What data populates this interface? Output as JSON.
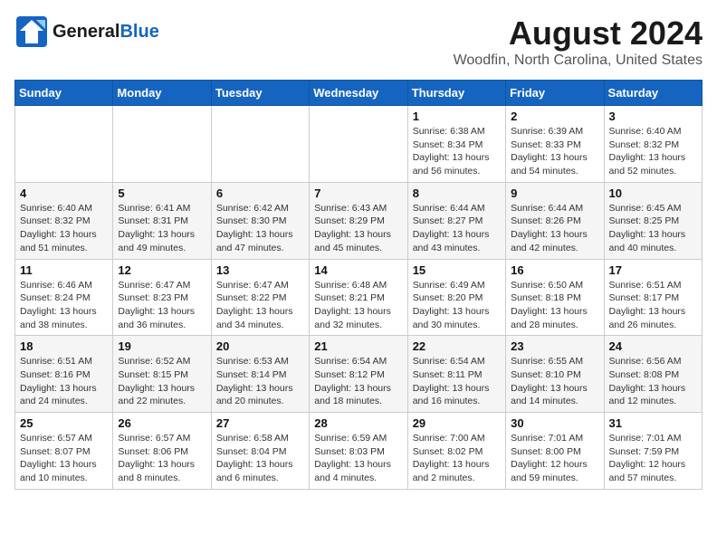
{
  "header": {
    "logo_line1": "General",
    "logo_line2": "Blue",
    "title": "August 2024",
    "subtitle": "Woodfin, North Carolina, United States"
  },
  "weekdays": [
    "Sunday",
    "Monday",
    "Tuesday",
    "Wednesday",
    "Thursday",
    "Friday",
    "Saturday"
  ],
  "weeks": [
    [
      {
        "day": "",
        "info": ""
      },
      {
        "day": "",
        "info": ""
      },
      {
        "day": "",
        "info": ""
      },
      {
        "day": "",
        "info": ""
      },
      {
        "day": "1",
        "info": "Sunrise: 6:38 AM\nSunset: 8:34 PM\nDaylight: 13 hours and 56 minutes."
      },
      {
        "day": "2",
        "info": "Sunrise: 6:39 AM\nSunset: 8:33 PM\nDaylight: 13 hours and 54 minutes."
      },
      {
        "day": "3",
        "info": "Sunrise: 6:40 AM\nSunset: 8:32 PM\nDaylight: 13 hours and 52 minutes."
      }
    ],
    [
      {
        "day": "4",
        "info": "Sunrise: 6:40 AM\nSunset: 8:32 PM\nDaylight: 13 hours and 51 minutes."
      },
      {
        "day": "5",
        "info": "Sunrise: 6:41 AM\nSunset: 8:31 PM\nDaylight: 13 hours and 49 minutes."
      },
      {
        "day": "6",
        "info": "Sunrise: 6:42 AM\nSunset: 8:30 PM\nDaylight: 13 hours and 47 minutes."
      },
      {
        "day": "7",
        "info": "Sunrise: 6:43 AM\nSunset: 8:29 PM\nDaylight: 13 hours and 45 minutes."
      },
      {
        "day": "8",
        "info": "Sunrise: 6:44 AM\nSunset: 8:27 PM\nDaylight: 13 hours and 43 minutes."
      },
      {
        "day": "9",
        "info": "Sunrise: 6:44 AM\nSunset: 8:26 PM\nDaylight: 13 hours and 42 minutes."
      },
      {
        "day": "10",
        "info": "Sunrise: 6:45 AM\nSunset: 8:25 PM\nDaylight: 13 hours and 40 minutes."
      }
    ],
    [
      {
        "day": "11",
        "info": "Sunrise: 6:46 AM\nSunset: 8:24 PM\nDaylight: 13 hours and 38 minutes."
      },
      {
        "day": "12",
        "info": "Sunrise: 6:47 AM\nSunset: 8:23 PM\nDaylight: 13 hours and 36 minutes."
      },
      {
        "day": "13",
        "info": "Sunrise: 6:47 AM\nSunset: 8:22 PM\nDaylight: 13 hours and 34 minutes."
      },
      {
        "day": "14",
        "info": "Sunrise: 6:48 AM\nSunset: 8:21 PM\nDaylight: 13 hours and 32 minutes."
      },
      {
        "day": "15",
        "info": "Sunrise: 6:49 AM\nSunset: 8:20 PM\nDaylight: 13 hours and 30 minutes."
      },
      {
        "day": "16",
        "info": "Sunrise: 6:50 AM\nSunset: 8:18 PM\nDaylight: 13 hours and 28 minutes."
      },
      {
        "day": "17",
        "info": "Sunrise: 6:51 AM\nSunset: 8:17 PM\nDaylight: 13 hours and 26 minutes."
      }
    ],
    [
      {
        "day": "18",
        "info": "Sunrise: 6:51 AM\nSunset: 8:16 PM\nDaylight: 13 hours and 24 minutes."
      },
      {
        "day": "19",
        "info": "Sunrise: 6:52 AM\nSunset: 8:15 PM\nDaylight: 13 hours and 22 minutes."
      },
      {
        "day": "20",
        "info": "Sunrise: 6:53 AM\nSunset: 8:14 PM\nDaylight: 13 hours and 20 minutes."
      },
      {
        "day": "21",
        "info": "Sunrise: 6:54 AM\nSunset: 8:12 PM\nDaylight: 13 hours and 18 minutes."
      },
      {
        "day": "22",
        "info": "Sunrise: 6:54 AM\nSunset: 8:11 PM\nDaylight: 13 hours and 16 minutes."
      },
      {
        "day": "23",
        "info": "Sunrise: 6:55 AM\nSunset: 8:10 PM\nDaylight: 13 hours and 14 minutes."
      },
      {
        "day": "24",
        "info": "Sunrise: 6:56 AM\nSunset: 8:08 PM\nDaylight: 13 hours and 12 minutes."
      }
    ],
    [
      {
        "day": "25",
        "info": "Sunrise: 6:57 AM\nSunset: 8:07 PM\nDaylight: 13 hours and 10 minutes."
      },
      {
        "day": "26",
        "info": "Sunrise: 6:57 AM\nSunset: 8:06 PM\nDaylight: 13 hours and 8 minutes."
      },
      {
        "day": "27",
        "info": "Sunrise: 6:58 AM\nSunset: 8:04 PM\nDaylight: 13 hours and 6 minutes."
      },
      {
        "day": "28",
        "info": "Sunrise: 6:59 AM\nSunset: 8:03 PM\nDaylight: 13 hours and 4 minutes."
      },
      {
        "day": "29",
        "info": "Sunrise: 7:00 AM\nSunset: 8:02 PM\nDaylight: 13 hours and 2 minutes."
      },
      {
        "day": "30",
        "info": "Sunrise: 7:01 AM\nSunset: 8:00 PM\nDaylight: 12 hours and 59 minutes."
      },
      {
        "day": "31",
        "info": "Sunrise: 7:01 AM\nSunset: 7:59 PM\nDaylight: 12 hours and 57 minutes."
      }
    ]
  ]
}
